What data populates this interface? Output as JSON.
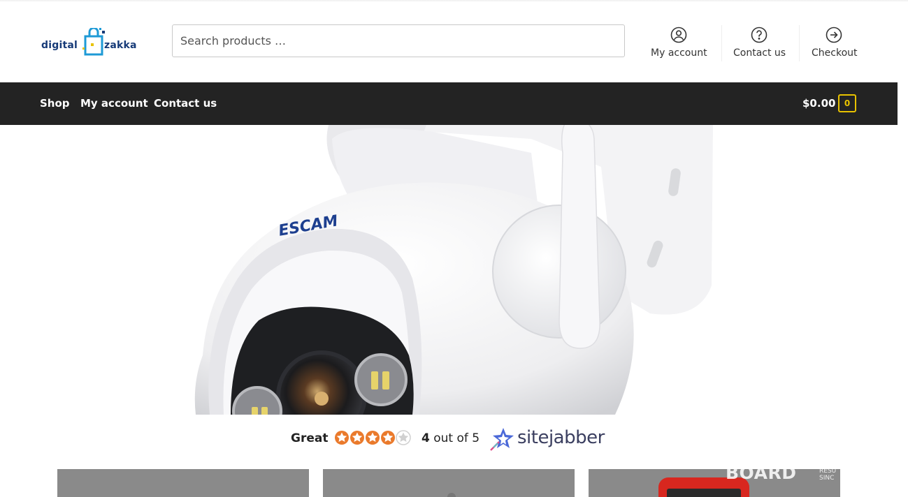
{
  "logo": {
    "part1": "digital",
    "part2": "zakka"
  },
  "search": {
    "placeholder": "Search products …"
  },
  "header_nav": [
    {
      "label": "My account",
      "icon": "user-circle-icon"
    },
    {
      "label": "Contact us",
      "icon": "help-circle-icon"
    },
    {
      "label": "Checkout",
      "icon": "arrow-right-circle-icon"
    }
  ],
  "main_nav": [
    {
      "label": "Shop"
    },
    {
      "label": "My account"
    },
    {
      "label": "Contact us"
    }
  ],
  "cart": {
    "amount": "$0.00",
    "count": "0"
  },
  "hero": {
    "brand_on_product": "ESCAM"
  },
  "rating": {
    "word": "Great",
    "score": "4",
    "out_of": "out of 5",
    "stars_filled": 4,
    "stars_total": 5,
    "provider": "sitejabber"
  },
  "watermark": {
    "text": "BOARD",
    "side_text_1": "RESU",
    "side_text_2": "SINC"
  },
  "colors": {
    "navbar_bg": "#232323",
    "accent_yellow": "#e8c200",
    "logo_blue": "#163a78",
    "star_orange": "#ea7a2c"
  }
}
